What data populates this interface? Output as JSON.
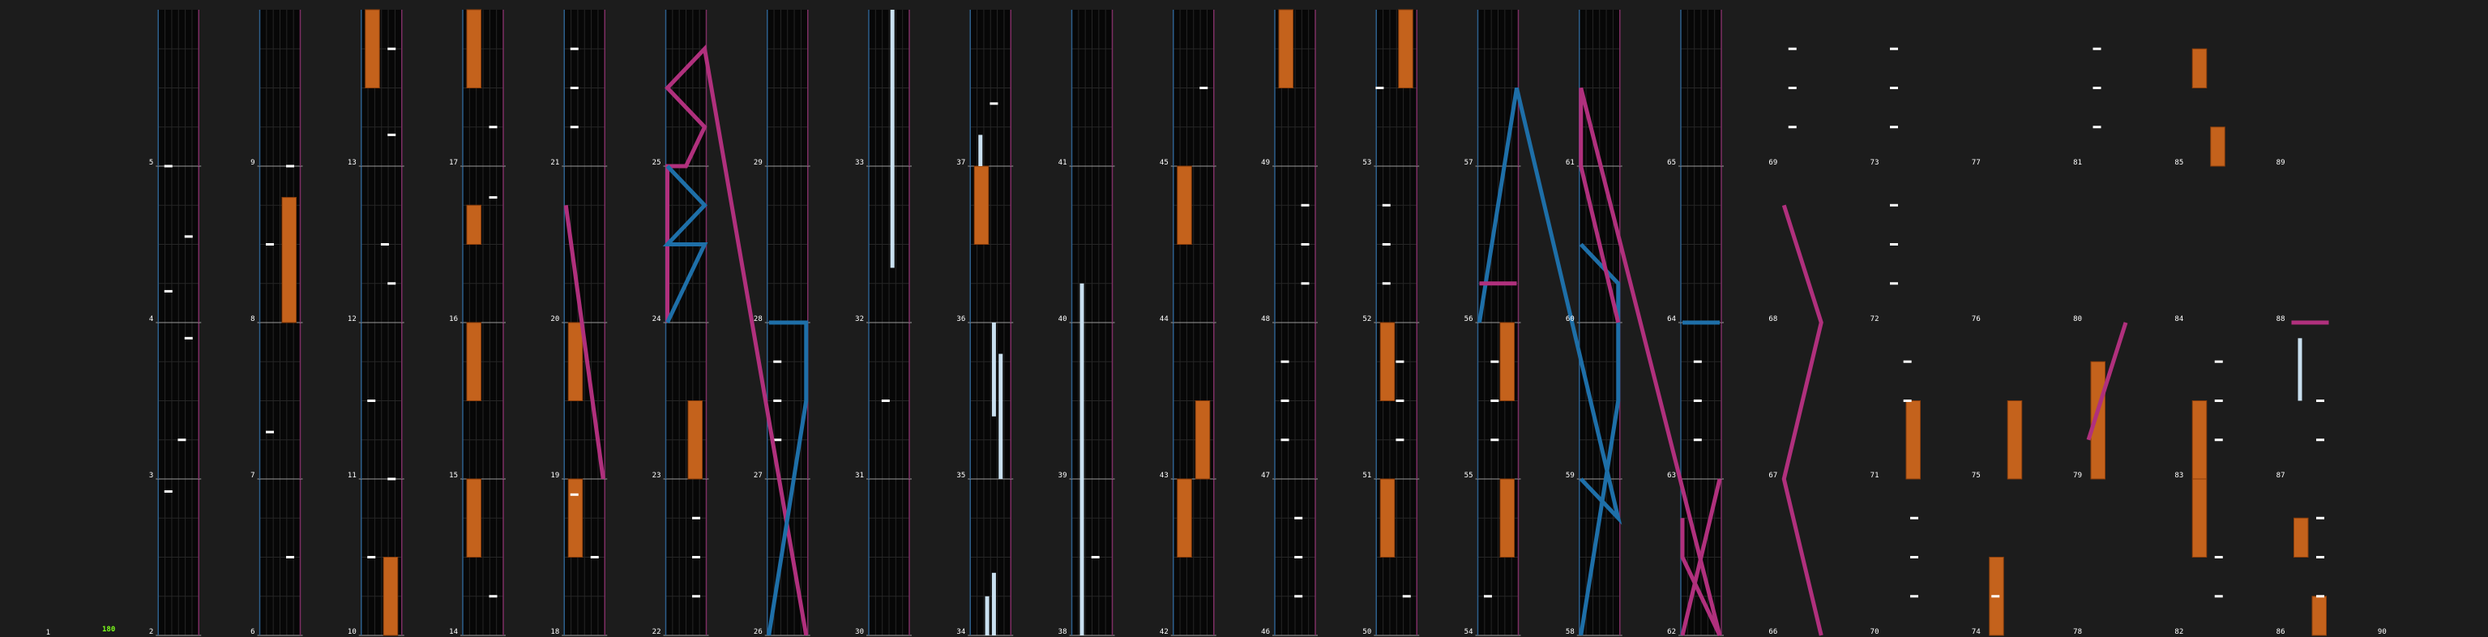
{
  "colors": {
    "background": "#1c1c1c",
    "lane_bg": "#070707",
    "lane_grid": "#262626",
    "measure_line": "#9a9a9a",
    "lane_border_left": "#2d5f8c",
    "lane_border_right": "#7d2e63",
    "note": "#ffffff",
    "charge_note": "#c9e0f0",
    "hold_note_fill": "#c4621c",
    "hold_note_edge": "#8a3e0c",
    "laser_left": "#1e6fa8",
    "laser_right": "#b0307d",
    "label_text": "#ffffff",
    "bpm_text": "#7dff1a"
  },
  "chart_data": {
    "type": "rhythm-game-chart",
    "columns": 16,
    "measures_per_column": 4,
    "lanes": 6,
    "bpm": "180",
    "start_measure_label": "1",
    "end_measure_label": "90",
    "measure_labels": [
      "1",
      "2",
      "3",
      "4",
      "5",
      "6",
      "7",
      "8",
      "9",
      "10",
      "11",
      "12",
      "13",
      "14",
      "15",
      "16",
      "17",
      "18",
      "19",
      "20",
      "21",
      "22",
      "23",
      "24",
      "25",
      "26",
      "27",
      "28",
      "29",
      "30",
      "31",
      "32",
      "33",
      "34",
      "35",
      "36",
      "37",
      "38",
      "39",
      "40",
      "41",
      "42",
      "43",
      "44",
      "45",
      "46",
      "47",
      "48",
      "49",
      "50",
      "51",
      "52",
      "53",
      "54",
      "55",
      "56",
      "57",
      "58",
      "59",
      "60",
      "61",
      "62",
      "63",
      "64",
      "65",
      "66",
      "67",
      "68",
      "69",
      "70",
      "71",
      "72",
      "73",
      "74",
      "75",
      "76",
      "77",
      "78",
      "79",
      "80",
      "81",
      "82",
      "83",
      "84",
      "85",
      "86",
      "87",
      "88",
      "89",
      "90"
    ],
    "notes": [
      {
        "m": 2,
        "p": 0.92,
        "lane": 1
      },
      {
        "m": 3,
        "p": 0.9,
        "lane": 4
      },
      {
        "m": 3,
        "p": 0.25,
        "lane": 3
      },
      {
        "m": 4,
        "p": 0.55,
        "lane": 4
      },
      {
        "m": 4,
        "p": 0.2,
        "lane": 1
      },
      {
        "m": 5,
        "p": 0.0,
        "lane": 1
      },
      {
        "m": 6,
        "p": 0.5,
        "lane": 4
      },
      {
        "m": 7,
        "p": 0.3,
        "lane": 1
      },
      {
        "m": 8,
        "p": 0.5,
        "lane": 1
      },
      {
        "m": 9,
        "p": 0.0,
        "lane": 4
      },
      {
        "m": 10,
        "p": 0.5,
        "lane": 1
      },
      {
        "m": 11,
        "p": 0.0,
        "lane": 4
      },
      {
        "m": 11,
        "p": 0.5,
        "lane": 1
      },
      {
        "m": 12,
        "p": 0.5,
        "lane": 3
      },
      {
        "m": 12,
        "p": 0.25,
        "lane": 4
      },
      {
        "m": 13,
        "p": 0.2,
        "lane": 4
      },
      {
        "m": 13,
        "p": 0.75,
        "lane": 4
      },
      {
        "m": 14,
        "p": 0.25,
        "lane": 4
      },
      {
        "m": 16,
        "p": 0.8,
        "lane": 4
      },
      {
        "m": 17,
        "p": 0.25,
        "lane": 4
      },
      {
        "m": 18,
        "p": 0.5,
        "lane": 4
      },
      {
        "m": 18,
        "p": 0.9,
        "lane": 1
      },
      {
        "m": 21,
        "p": 0.25,
        "lane": 1
      },
      {
        "m": 21,
        "p": 0.5,
        "lane": 1
      },
      {
        "m": 21,
        "p": 0.75,
        "lane": 1
      },
      {
        "m": 22,
        "p": 0.25,
        "lane": 4
      },
      {
        "m": 22,
        "p": 0.5,
        "lane": 4
      },
      {
        "m": 22,
        "p": 0.75,
        "lane": 4
      },
      {
        "m": 27,
        "p": 0.25,
        "lane": 1
      },
      {
        "m": 27,
        "p": 0.5,
        "lane": 1
      },
      {
        "m": 27,
        "p": 0.75,
        "lane": 1
      },
      {
        "m": 31,
        "p": 0.5,
        "lane": 2
      },
      {
        "m": 37,
        "p": 0.4,
        "lane": 3
      },
      {
        "m": 38,
        "p": 0.5,
        "lane": 3
      },
      {
        "m": 45,
        "p": 0.5,
        "lane": 4
      },
      {
        "m": 46,
        "p": 0.25,
        "lane": 3
      },
      {
        "m": 46,
        "p": 0.5,
        "lane": 3
      },
      {
        "m": 46,
        "p": 0.75,
        "lane": 3
      },
      {
        "m": 47,
        "p": 0.25,
        "lane": 1
      },
      {
        "m": 47,
        "p": 0.5,
        "lane": 1
      },
      {
        "m": 47,
        "p": 0.75,
        "lane": 1
      },
      {
        "m": 48,
        "p": 0.25,
        "lane": 4
      },
      {
        "m": 48,
        "p": 0.5,
        "lane": 4
      },
      {
        "m": 48,
        "p": 0.75,
        "lane": 4
      },
      {
        "m": 50,
        "p": 0.25,
        "lane": 4
      },
      {
        "m": 51,
        "p": 0.25,
        "lane": 3
      },
      {
        "m": 51,
        "p": 0.5,
        "lane": 3
      },
      {
        "m": 51,
        "p": 0.75,
        "lane": 3
      },
      {
        "m": 52,
        "p": 0.25,
        "lane": 1
      },
      {
        "m": 52,
        "p": 0.5,
        "lane": 1
      },
      {
        "m": 52,
        "p": 0.75,
        "lane": 1
      },
      {
        "m": 53,
        "p": 0.5,
        "lane": 0
      },
      {
        "m": 54,
        "p": 0.25,
        "lane": 1
      },
      {
        "m": 55,
        "p": 0.25,
        "lane": 2
      },
      {
        "m": 55,
        "p": 0.5,
        "lane": 2
      },
      {
        "m": 55,
        "p": 0.75,
        "lane": 2
      },
      {
        "m": 63,
        "p": 0.25,
        "lane": 2
      },
      {
        "m": 63,
        "p": 0.5,
        "lane": 2
      },
      {
        "m": 63,
        "p": 0.75,
        "lane": 2
      },
      {
        "m": 69,
        "p": 0.25,
        "lane": 1
      },
      {
        "m": 69,
        "p": 0.5,
        "lane": 1
      },
      {
        "m": 69,
        "p": 0.75,
        "lane": 1
      },
      {
        "m": 70,
        "p": 0.25,
        "lane": 4
      },
      {
        "m": 70,
        "p": 0.5,
        "lane": 4
      },
      {
        "m": 70,
        "p": 0.75,
        "lane": 4
      },
      {
        "m": 71,
        "p": 0.5,
        "lane": 3
      },
      {
        "m": 71,
        "p": 0.75,
        "lane": 3
      },
      {
        "m": 72,
        "p": 0.25,
        "lane": 1
      },
      {
        "m": 72,
        "p": 0.5,
        "lane": 1
      },
      {
        "m": 72,
        "p": 0.75,
        "lane": 1
      },
      {
        "m": 73,
        "p": 0.25,
        "lane": 1
      },
      {
        "m": 73,
        "p": 0.5,
        "lane": 1
      },
      {
        "m": 73,
        "p": 0.75,
        "lane": 1
      },
      {
        "m": 74,
        "p": 0.25,
        "lane": 1
      },
      {
        "m": 81,
        "p": 0.25,
        "lane": 1
      },
      {
        "m": 81,
        "p": 0.5,
        "lane": 1
      },
      {
        "m": 81,
        "p": 0.75,
        "lane": 1
      },
      {
        "m": 82,
        "p": 0.25,
        "lane": 4
      },
      {
        "m": 82,
        "p": 0.5,
        "lane": 4
      },
      {
        "m": 83,
        "p": 0.25,
        "lane": 4
      },
      {
        "m": 83,
        "p": 0.5,
        "lane": 4
      },
      {
        "m": 83,
        "p": 0.75,
        "lane": 4
      },
      {
        "m": 86,
        "p": 0.25,
        "lane": 4
      },
      {
        "m": 86,
        "p": 0.5,
        "lane": 4
      },
      {
        "m": 86,
        "p": 0.75,
        "lane": 4
      },
      {
        "m": 87,
        "p": 0.25,
        "lane": 4
      },
      {
        "m": 87,
        "p": 0.5,
        "lane": 4
      }
    ],
    "holds": [
      {
        "m": 10,
        "from": 0.0,
        "to": 0.5,
        "lane": 3,
        "kind": "fx"
      },
      {
        "m": 8,
        "from": 0.0,
        "to": 0.8,
        "lane": 3,
        "kind": "fx"
      },
      {
        "m": 13,
        "from": 0.5,
        "to": 1.0,
        "lane": 1,
        "kind": "fx"
      },
      {
        "m": 14,
        "from": 0.5,
        "to": 1.0,
        "lane": 1,
        "kind": "fx"
      },
      {
        "m": 15,
        "from": 0.5,
        "to": 1.0,
        "lane": 1,
        "kind": "fx"
      },
      {
        "m": 16,
        "from": 0.5,
        "to": 0.75,
        "lane": 1,
        "kind": "fx"
      },
      {
        "m": 17,
        "from": 0.5,
        "to": 1.0,
        "lane": 1,
        "kind": "fx"
      },
      {
        "m": 18,
        "from": 0.5,
        "to": 1.0,
        "lane": 1,
        "kind": "fx"
      },
      {
        "m": 19,
        "from": 0.5,
        "to": 1.0,
        "lane": 1,
        "kind": "fx"
      },
      {
        "m": 23,
        "from": 0.0,
        "to": 0.5,
        "lane": 3,
        "kind": "fx"
      },
      {
        "m": 36,
        "from": 0.5,
        "to": 1.0,
        "lane": 1,
        "kind": "fx"
      },
      {
        "m": 42,
        "from": 0.5,
        "to": 1.0,
        "lane": 1,
        "kind": "fx"
      },
      {
        "m": 43,
        "from": 0.0,
        "to": 0.5,
        "lane": 3,
        "kind": "fx"
      },
      {
        "m": 44,
        "from": 0.5,
        "to": 1.0,
        "lane": 1,
        "kind": "fx"
      },
      {
        "m": 49,
        "from": 0.5,
        "to": 1.0,
        "lane": 1,
        "kind": "fx"
      },
      {
        "m": 50,
        "from": 0.5,
        "to": 1.0,
        "lane": 1,
        "kind": "fx"
      },
      {
        "m": 51,
        "from": 0.5,
        "to": 1.0,
        "lane": 1,
        "kind": "fx"
      },
      {
        "m": 53,
        "from": 0.5,
        "to": 1.0,
        "lane": 3,
        "kind": "fx"
      },
      {
        "m": 54,
        "from": 0.5,
        "to": 1.0,
        "lane": 3,
        "kind": "fx"
      },
      {
        "m": 55,
        "from": 0.5,
        "to": 1.0,
        "lane": 3,
        "kind": "fx"
      },
      {
        "m": 71,
        "from": 0.0,
        "to": 0.5,
        "lane": 3,
        "kind": "fx"
      },
      {
        "m": 74,
        "from": 0.0,
        "to": 0.5,
        "lane": 1,
        "kind": "fx"
      },
      {
        "m": 75,
        "from": 0.0,
        "to": 0.5,
        "lane": 3,
        "kind": "fx"
      },
      {
        "m": 79,
        "from": 0.0,
        "to": 0.75,
        "lane": 1,
        "kind": "fx"
      },
      {
        "m": 82,
        "from": 0.5,
        "to": 1.0,
        "lane": 1,
        "kind": "fx"
      },
      {
        "m": 83,
        "from": 0.0,
        "to": 0.5,
        "lane": 1,
        "kind": "fx"
      },
      {
        "m": 85,
        "from": 0.0,
        "to": 0.25,
        "lane": 3,
        "kind": "fx"
      },
      {
        "m": 85,
        "from": 0.5,
        "to": 0.75,
        "lane": 1,
        "kind": "fx"
      },
      {
        "m": 86,
        "from": 0.0,
        "to": 0.25,
        "lane": 3,
        "kind": "fx"
      },
      {
        "m": 86,
        "from": 0.5,
        "to": 0.75,
        "lane": 1,
        "kind": "fx"
      },
      {
        "m": 32,
        "from": 0.35,
        "to": 1.0,
        "lane": 3,
        "kind": "bt"
      },
      {
        "m": 33,
        "from": 0.0,
        "to": 1.0,
        "lane": 3,
        "kind": "bt"
      },
      {
        "m": 34,
        "from": 0.0,
        "to": 0.4,
        "lane": 3,
        "kind": "bt"
      },
      {
        "m": 35,
        "from": 0.4,
        "to": 1.0,
        "lane": 3,
        "kind": "bt"
      },
      {
        "m": 34,
        "from": 0.0,
        "to": 0.25,
        "lane": 2,
        "kind": "bt"
      },
      {
        "m": 35,
        "from": 0.0,
        "to": 0.8,
        "lane": 4,
        "kind": "bt"
      },
      {
        "m": 37,
        "from": 0.0,
        "to": 0.2,
        "lane": 1,
        "kind": "bt"
      },
      {
        "m": 38,
        "from": 0.0,
        "to": 1.0,
        "lane": 1,
        "kind": "bt"
      },
      {
        "m": 39,
        "from": 0.0,
        "to": 1.0,
        "lane": 1,
        "kind": "bt"
      },
      {
        "m": 40,
        "from": 0.0,
        "to": 0.25,
        "lane": 1,
        "kind": "bt"
      },
      {
        "m": 87,
        "from": 0.5,
        "to": 0.9,
        "lane": 1,
        "kind": "bt"
      }
    ],
    "lasers": [
      {
        "side": "right",
        "points": [
          [
            24.0,
            0.0
          ],
          [
            25.0,
            0.0
          ],
          [
            25.0,
            0.5
          ],
          [
            25.25,
            1.0
          ],
          [
            25.5,
            0.0
          ],
          [
            25.75,
            1.0
          ],
          [
            26.0,
            1.0
          ]
        ]
      },
      {
        "side": "left",
        "points": [
          [
            24.0,
            0.0
          ],
          [
            24.5,
            1.0
          ],
          [
            24.5,
            0.0
          ],
          [
            24.75,
            1.0
          ],
          [
            25.0,
            0.0
          ]
        ]
      },
      {
        "side": "left",
        "points": [
          [
            26.0,
            0.0
          ],
          [
            27.5,
            1.0
          ],
          [
            28.0,
            1.0
          ],
          [
            28.0,
            0.0
          ]
        ]
      },
      {
        "side": "right",
        "points": [
          [
            19.0,
            1.0
          ],
          [
            20.75,
            0.0
          ]
        ]
      },
      {
        "side": "left",
        "points": [
          [
            56.0,
            0.0
          ],
          [
            57.5,
            1.0
          ],
          [
            58.75,
            1.0
          ],
          [
            59.0,
            0.0
          ]
        ]
      },
      {
        "side": "right",
        "points": [
          [
            56.25,
            0.0
          ],
          [
            56.25,
            1.0
          ]
        ]
      },
      {
        "side": "left",
        "points": [
          [
            58.0,
            0.0
          ],
          [
            59.5,
            1.0
          ],
          [
            60.25,
            1.0
          ],
          [
            60.5,
            0.0
          ]
        ]
      },
      {
        "side": "right",
        "points": [
          [
            60.0,
            1.0
          ],
          [
            61.0,
            0.0
          ],
          [
            61.5,
            0.0
          ],
          [
            62.0,
            1.0
          ],
          [
            62.5,
            0.0
          ],
          [
            62.75,
            0.0
          ]
        ]
      },
      {
        "side": "right",
        "points": [
          [
            62.0,
            0.0
          ],
          [
            63.0,
            1.0
          ]
        ]
      },
      {
        "side": "left",
        "points": [
          [
            64.0,
            0.0
          ],
          [
            64.0,
            1.0
          ]
        ]
      },
      {
        "side": "right",
        "points": [
          [
            66.0,
            1.0
          ],
          [
            67.0,
            0.0
          ],
          [
            68.0,
            1.0
          ],
          [
            68.75,
            0.0
          ]
        ]
      },
      {
        "side": "right",
        "points": [
          [
            79.25,
            0.0
          ],
          [
            80.0,
            1.0
          ]
        ]
      },
      {
        "side": "right",
        "points": [
          [
            88.0,
            0.0
          ],
          [
            88.0,
            1.0
          ]
        ]
      }
    ]
  }
}
